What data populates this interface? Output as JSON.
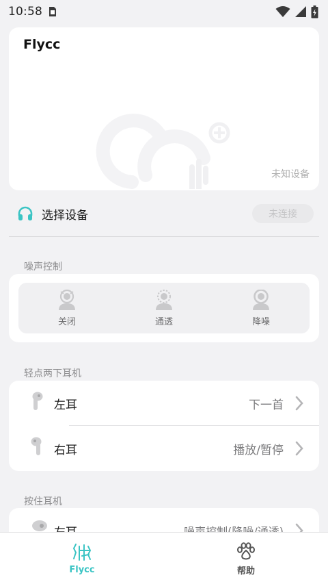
{
  "status_bar": {
    "time": "10:58"
  },
  "device_card": {
    "name": "Flycc",
    "model": "未知设备"
  },
  "select_device": {
    "label": "选择设备",
    "status_button": "未连接"
  },
  "noise_control": {
    "title": "噪声控制",
    "options": [
      {
        "label": "关闭",
        "icon": "person-off-icon"
      },
      {
        "label": "通透",
        "icon": "person-transparency-icon"
      },
      {
        "label": "降噪",
        "icon": "person-anc-icon"
      }
    ]
  },
  "double_tap": {
    "title": "轻点两下耳机",
    "rows": [
      {
        "label": "左耳",
        "value": "下一首"
      },
      {
        "label": "右耳",
        "value": "播放/暂停"
      }
    ]
  },
  "press_hold": {
    "title": "按住耳机",
    "rows": [
      {
        "label": "左耳",
        "value": "噪声控制(降噪/通透)"
      }
    ]
  },
  "tabbar": {
    "tabs": [
      {
        "label": "Flycc",
        "icon": "flycc-logo-icon",
        "active": true
      },
      {
        "label": "帮助",
        "icon": "paw-icon",
        "active": false
      }
    ]
  },
  "colors": {
    "accent": "#3bc4c4",
    "inactive_tab": "#555555"
  }
}
